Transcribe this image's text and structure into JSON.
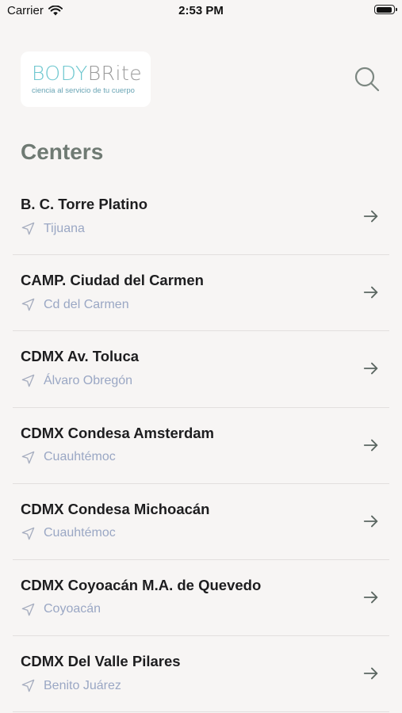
{
  "status_bar": {
    "carrier": "Carrier",
    "time": "2:53 PM",
    "icons": [
      "wifi-icon",
      "battery-icon"
    ]
  },
  "header": {
    "logo": {
      "brand_part1": "BODY",
      "brand_part2": "BRite",
      "tagline": "ciencia al servicio de tu cuerpo"
    },
    "search_icon": "search-icon"
  },
  "page": {
    "title": "Centers"
  },
  "centers": [
    {
      "name": "B. C. Torre Platino",
      "city": "Tijuana"
    },
    {
      "name": "CAMP. Ciudad del Carmen",
      "city": "Cd del Carmen"
    },
    {
      "name": "CDMX Av. Toluca",
      "city": "Álvaro Obregón"
    },
    {
      "name": "CDMX Condesa Amsterdam",
      "city": "Cuauhtémoc"
    },
    {
      "name": "CDMX Condesa Michoacán",
      "city": "Cuauhtémoc"
    },
    {
      "name": "CDMX Coyoacán M.A. de Quevedo",
      "city": "Coyoacán"
    },
    {
      "name": "CDMX Del Valle Pilares",
      "city": "Benito Juárez"
    }
  ],
  "colors": {
    "background": "#f7f5f4",
    "title": "#6f7a73",
    "city": "#9aa7c4",
    "logo_teal": "#6ec7cf",
    "logo_gray": "#9a9a9a",
    "divider": "#e2dfde"
  }
}
